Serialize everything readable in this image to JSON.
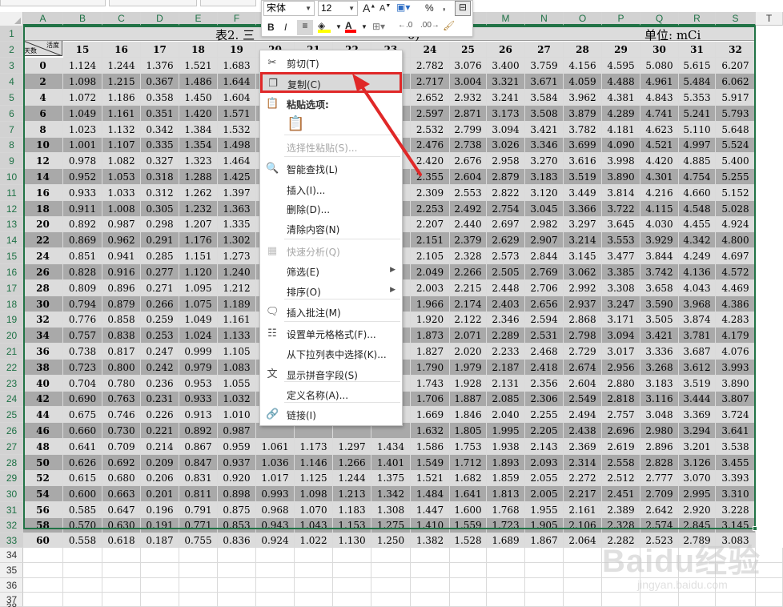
{
  "spreadsheet": {
    "columns": [
      "A",
      "B",
      "C",
      "D",
      "E",
      "F",
      "G",
      "H",
      "I",
      "J",
      "K",
      "L",
      "M",
      "N",
      "O",
      "P",
      "Q",
      "R",
      "S",
      "T"
    ],
    "rows": [
      1,
      2,
      3,
      4,
      5,
      6,
      7,
      8,
      9,
      10,
      11,
      12,
      13,
      14,
      15,
      16,
      17,
      18,
      19,
      20,
      21,
      22,
      23,
      24,
      25,
      26,
      27,
      28,
      29,
      30,
      31,
      32,
      33,
      34,
      35,
      36,
      37,
      38
    ],
    "title_left": "表2. 三",
    "title_right": "0)",
    "unit_label": "单位: mCi",
    "header_corner_top": "活度",
    "header_corner_bottom": "天数",
    "header_values": [
      "15",
      "16",
      "17",
      "18",
      "19",
      "20",
      "21",
      "22",
      "23",
      "24",
      "25",
      "26",
      "27",
      "28",
      "29",
      "30",
      "31",
      "32"
    ],
    "day_values": [
      "0",
      "2",
      "4",
      "6",
      "8",
      "10",
      "12",
      "14",
      "16",
      "18",
      "20",
      "22",
      "24",
      "26",
      "28",
      "30",
      "32",
      "34",
      "36",
      "38",
      "40",
      "42",
      "44",
      "46",
      "48",
      "50",
      "52",
      "54",
      "56",
      "58",
      "60"
    ],
    "table_rows": [
      [
        "1.124",
        "1.244",
        "1.376",
        "1.521",
        "1.683",
        "",
        "",
        "",
        "",
        "2.782",
        "3.076",
        "3.400",
        "3.759",
        "4.156",
        "4.595",
        "5.080",
        "5.615",
        "6.207"
      ],
      [
        "1.098",
        "1.215",
        "0.367",
        "1.486",
        "1.644",
        "",
        "",
        "",
        "",
        "2.717",
        "3.004",
        "3.321",
        "3.671",
        "4.059",
        "4.488",
        "4.961",
        "5.484",
        "6.062"
      ],
      [
        "1.072",
        "1.186",
        "0.358",
        "1.450",
        "1.604",
        "",
        "",
        "",
        "",
        "2.652",
        "2.932",
        "3.241",
        "3.584",
        "3.962",
        "4.381",
        "4.843",
        "5.353",
        "5.917"
      ],
      [
        "1.049",
        "1.161",
        "0.351",
        "1.420",
        "1.571",
        "",
        "",
        "",
        "",
        "2.597",
        "2.871",
        "3.173",
        "3.508",
        "3.879",
        "4.289",
        "4.741",
        "5.241",
        "5.793"
      ],
      [
        "1.023",
        "1.132",
        "0.342",
        "1.384",
        "1.532",
        "",
        "",
        "",
        "",
        "2.532",
        "2.799",
        "3.094",
        "3.421",
        "3.782",
        "4.181",
        "4.623",
        "5.110",
        "5.648"
      ],
      [
        "1.001",
        "1.107",
        "0.335",
        "1.354",
        "1.498",
        "",
        "",
        "",
        "",
        "2.476",
        "2.738",
        "3.026",
        "3.346",
        "3.699",
        "4.090",
        "4.521",
        "4.997",
        "5.524"
      ],
      [
        "0.978",
        "1.082",
        "0.327",
        "1.323",
        "1.464",
        "",
        "",
        "",
        "",
        "2.420",
        "2.676",
        "2.958",
        "3.270",
        "3.616",
        "3.998",
        "4.420",
        "4.885",
        "5.400"
      ],
      [
        "0.952",
        "1.053",
        "0.318",
        "1.288",
        "1.425",
        "",
        "",
        "",
        "",
        "2.355",
        "2.604",
        "2.879",
        "3.183",
        "3.519",
        "3.890",
        "4.301",
        "4.754",
        "5.255"
      ],
      [
        "0.933",
        "1.033",
        "0.312",
        "1.262",
        "1.397",
        "",
        "",
        "",
        "",
        "2.309",
        "2.553",
        "2.822",
        "3.120",
        "3.449",
        "3.814",
        "4.216",
        "4.660",
        "5.152"
      ],
      [
        "0.911",
        "1.008",
        "0.305",
        "1.232",
        "1.363",
        "",
        "",
        "",
        "",
        "2.253",
        "2.492",
        "2.754",
        "3.045",
        "3.366",
        "3.722",
        "4.115",
        "4.548",
        "5.028"
      ],
      [
        "0.892",
        "0.987",
        "0.298",
        "1.207",
        "1.335",
        "",
        "",
        "",
        "",
        "2.207",
        "2.440",
        "2.697",
        "2.982",
        "3.297",
        "3.645",
        "4.030",
        "4.455",
        "4.924"
      ],
      [
        "0.869",
        "0.962",
        "0.291",
        "1.176",
        "1.302",
        "",
        "",
        "",
        "",
        "2.151",
        "2.379",
        "2.629",
        "2.907",
        "3.214",
        "3.553",
        "3.929",
        "4.342",
        "4.800"
      ],
      [
        "0.851",
        "0.941",
        "0.285",
        "1.151",
        "1.273",
        "",
        "",
        "",
        "",
        "2.105",
        "2.328",
        "2.573",
        "2.844",
        "3.145",
        "3.477",
        "3.844",
        "4.249",
        "4.697"
      ],
      [
        "0.828",
        "0.916",
        "0.277",
        "1.120",
        "1.240",
        "",
        "",
        "",
        "",
        "2.049",
        "2.266",
        "2.505",
        "2.769",
        "3.062",
        "3.385",
        "3.742",
        "4.136",
        "4.572"
      ],
      [
        "0.809",
        "0.896",
        "0.271",
        "1.095",
        "1.212",
        "",
        "",
        "",
        "",
        "2.003",
        "2.215",
        "2.448",
        "2.706",
        "2.992",
        "3.308",
        "3.658",
        "4.043",
        "4.469"
      ],
      [
        "0.794",
        "0.879",
        "0.266",
        "1.075",
        "1.189",
        "",
        "",
        "",
        "",
        "1.966",
        "2.174",
        "2.403",
        "2.656",
        "2.937",
        "3.247",
        "3.590",
        "3.968",
        "4.386"
      ],
      [
        "0.776",
        "0.858",
        "0.259",
        "1.049",
        "1.161",
        "",
        "",
        "",
        "",
        "1.920",
        "2.122",
        "2.346",
        "2.594",
        "2.868",
        "3.171",
        "3.505",
        "3.874",
        "4.283"
      ],
      [
        "0.757",
        "0.838",
        "0.253",
        "1.024",
        "1.133",
        "",
        "",
        "",
        "",
        "1.873",
        "2.071",
        "2.289",
        "2.531",
        "2.798",
        "3.094",
        "3.421",
        "3.781",
        "4.179"
      ],
      [
        "0.738",
        "0.817",
        "0.247",
        "0.999",
        "1.105",
        "",
        "",
        "",
        "",
        "1.827",
        "2.020",
        "2.233",
        "2.468",
        "2.729",
        "3.017",
        "3.336",
        "3.687",
        "4.076"
      ],
      [
        "0.723",
        "0.800",
        "0.242",
        "0.979",
        "1.083",
        "",
        "",
        "",
        "",
        "1.790",
        "1.979",
        "2.187",
        "2.418",
        "2.674",
        "2.956",
        "3.268",
        "3.612",
        "3.993"
      ],
      [
        "0.704",
        "0.780",
        "0.236",
        "0.953",
        "1.055",
        "",
        "",
        "",
        "",
        "1.743",
        "1.928",
        "2.131",
        "2.356",
        "2.604",
        "2.880",
        "3.183",
        "3.519",
        "3.890"
      ],
      [
        "0.690",
        "0.763",
        "0.231",
        "0.933",
        "1.032",
        "",
        "",
        "",
        "",
        "1.706",
        "1.887",
        "2.085",
        "2.306",
        "2.549",
        "2.818",
        "3.116",
        "3.444",
        "3.807"
      ],
      [
        "0.675",
        "0.746",
        "0.226",
        "0.913",
        "1.010",
        "",
        "",
        "",
        "",
        "1.669",
        "1.846",
        "2.040",
        "2.255",
        "2.494",
        "2.757",
        "3.048",
        "3.369",
        "3.724"
      ],
      [
        "0.660",
        "0.730",
        "0.221",
        "0.892",
        "0.987",
        "",
        "",
        "",
        "",
        "1.632",
        "1.805",
        "1.995",
        "2.205",
        "2.438",
        "2.696",
        "2.980",
        "3.294",
        "3.641"
      ],
      [
        "0.641",
        "0.709",
        "0.214",
        "0.867",
        "0.959",
        "1.061",
        "1.173",
        "1.297",
        "1.434",
        "1.586",
        "1.753",
        "1.938",
        "2.143",
        "2.369",
        "2.619",
        "2.896",
        "3.201",
        "3.538"
      ],
      [
        "0.626",
        "0.692",
        "0.209",
        "0.847",
        "0.937",
        "1.036",
        "1.146",
        "1.266",
        "1.401",
        "1.549",
        "1.712",
        "1.893",
        "2.093",
        "2.314",
        "2.558",
        "2.828",
        "3.126",
        "3.455"
      ],
      [
        "0.615",
        "0.680",
        "0.206",
        "0.831",
        "0.920",
        "1.017",
        "1.125",
        "1.244",
        "1.375",
        "1.521",
        "1.682",
        "1.859",
        "2.055",
        "2.272",
        "2.512",
        "2.777",
        "3.070",
        "3.393"
      ],
      [
        "0.600",
        "0.663",
        "0.201",
        "0.811",
        "0.898",
        "0.993",
        "1.098",
        "1.213",
        "1.342",
        "1.484",
        "1.641",
        "1.813",
        "2.005",
        "2.217",
        "2.451",
        "2.709",
        "2.995",
        "3.310"
      ],
      [
        "0.585",
        "0.647",
        "0.196",
        "0.791",
        "0.875",
        "0.968",
        "1.070",
        "1.183",
        "1.308",
        "1.447",
        "1.600",
        "1.768",
        "1.955",
        "2.161",
        "2.389",
        "2.642",
        "2.920",
        "3.228"
      ],
      [
        "0.570",
        "0.630",
        "0.191",
        "0.771",
        "0.853",
        "0.943",
        "1.043",
        "1.153",
        "1.275",
        "1.410",
        "1.559",
        "1.723",
        "1.905",
        "2.106",
        "2.328",
        "2.574",
        "2.845",
        "3.145"
      ],
      [
        "0.558",
        "0.618",
        "0.187",
        "0.755",
        "0.836",
        "0.924",
        "1.022",
        "1.130",
        "1.250",
        "1.382",
        "1.528",
        "1.689",
        "1.867",
        "2.064",
        "2.282",
        "2.523",
        "2.789",
        "3.083"
      ]
    ]
  },
  "mini_toolbar": {
    "font_name": "宋体",
    "font_size": "12",
    "grow_label": "A",
    "shrink_label": "A",
    "percent_label": "%",
    "comma_label": ",",
    "bold_label": "B",
    "italic_label": "I",
    "font_color_label": "A",
    "fill_color": "#ffff00",
    "font_color": "#ff0000"
  },
  "context_menu": {
    "items": [
      {
        "label": "剪切(T)",
        "icon": "scissors-icon",
        "glyph": "✂",
        "disabled": false
      },
      {
        "label": "复制(C)",
        "icon": "copy-icon",
        "glyph": "❐",
        "disabled": false,
        "highlighted": true
      },
      {
        "label": "粘贴选项:",
        "icon": "paste-icon",
        "glyph": "📋",
        "disabled": false,
        "header": true
      },
      {
        "label": "",
        "icon": "paste-option-icon",
        "glyph": "📋",
        "disabled": true
      },
      {
        "label": "选择性粘贴(S)...",
        "icon": "",
        "glyph": "",
        "disabled": true
      },
      {
        "label": "智能查找(L)",
        "icon": "search-icon",
        "glyph": "🔍",
        "disabled": false
      },
      {
        "label": "插入(I)...",
        "icon": "",
        "glyph": "",
        "disabled": false
      },
      {
        "label": "删除(D)...",
        "icon": "",
        "glyph": "",
        "disabled": false
      },
      {
        "label": "清除内容(N)",
        "icon": "",
        "glyph": "",
        "disabled": false
      },
      {
        "label": "快速分析(Q)",
        "icon": "quick-analysis-icon",
        "glyph": "▦",
        "disabled": true
      },
      {
        "label": "筛选(E)",
        "icon": "",
        "glyph": "",
        "disabled": false,
        "submenu": true
      },
      {
        "label": "排序(O)",
        "icon": "",
        "glyph": "",
        "disabled": false,
        "submenu": true
      },
      {
        "label": "插入批注(M)",
        "icon": "comment-icon",
        "glyph": "🗨",
        "disabled": false
      },
      {
        "label": "设置单元格格式(F)...",
        "icon": "format-cells-icon",
        "glyph": "☷",
        "disabled": false
      },
      {
        "label": "从下拉列表中选择(K)...",
        "icon": "",
        "glyph": "",
        "disabled": false
      },
      {
        "label": "显示拼音字段(S)",
        "icon": "phonetic-icon",
        "glyph": "文",
        "disabled": false
      },
      {
        "label": "定义名称(A)...",
        "icon": "",
        "glyph": "",
        "disabled": false
      },
      {
        "label": "链接(I)",
        "icon": "link-icon",
        "glyph": "🔗",
        "disabled": false
      }
    ]
  },
  "watermark": {
    "brand": "Baidu经验",
    "url": "jingyan.baidu.com"
  },
  "colors": {
    "selection": "#217346",
    "highlight": "#e02828",
    "dark_row": "#a9a9a9",
    "light_row": "#dcdcdc"
  }
}
